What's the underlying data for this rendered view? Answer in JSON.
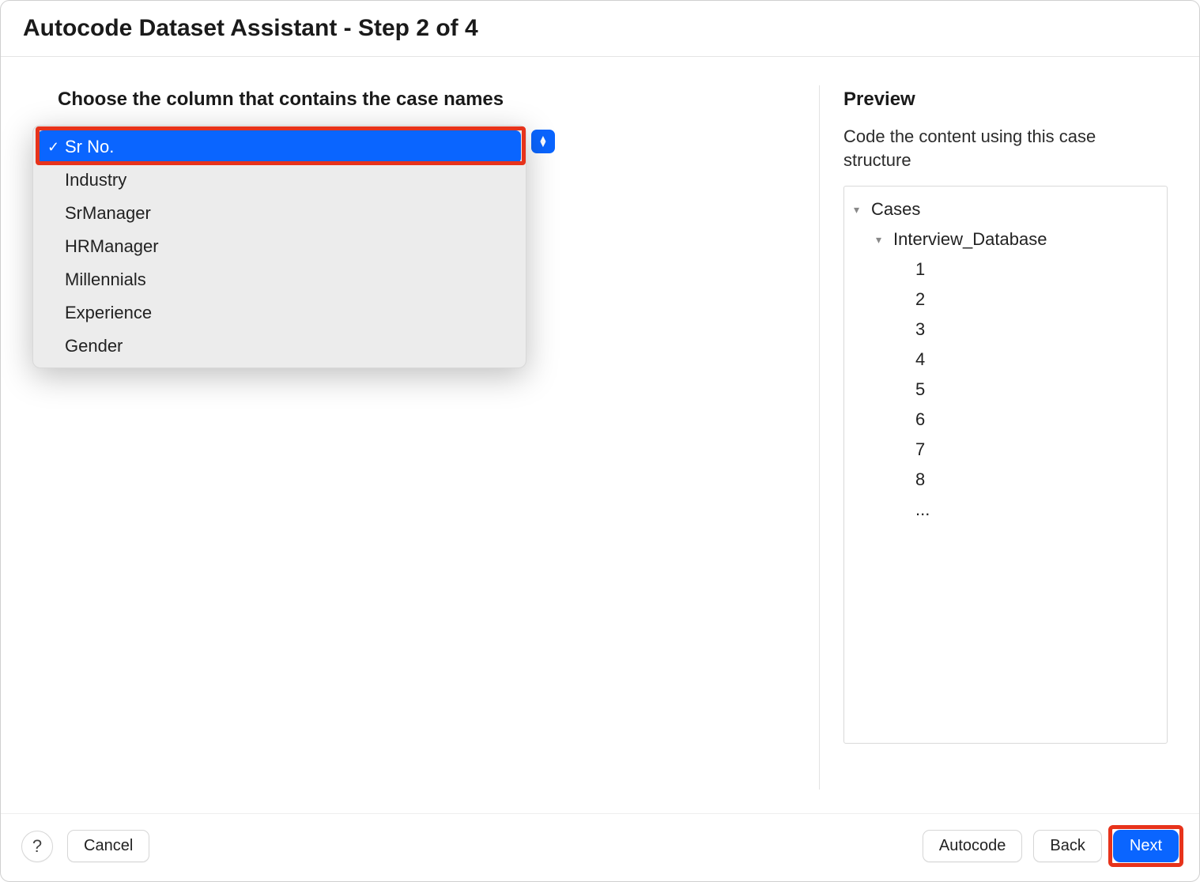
{
  "window": {
    "title": "Autocode Dataset Assistant - Step 2 of 4"
  },
  "header_prompt": "Choose the column that contains the case names",
  "dropdown": {
    "selected": "Sr No.",
    "options": [
      "Sr No.",
      "Industry",
      "SrManager",
      "HRManager",
      "Millennials",
      "Experience",
      "Gender"
    ]
  },
  "preview": {
    "title": "Preview",
    "description": "Code the content using this case structure",
    "tree": {
      "root": "Cases",
      "child": "Interview_Database",
      "items": [
        "1",
        "2",
        "3",
        "4",
        "5",
        "6",
        "7",
        "8",
        "..."
      ]
    }
  },
  "footer": {
    "help": "?",
    "cancel": "Cancel",
    "autocode": "Autocode",
    "back": "Back",
    "next": "Next"
  }
}
